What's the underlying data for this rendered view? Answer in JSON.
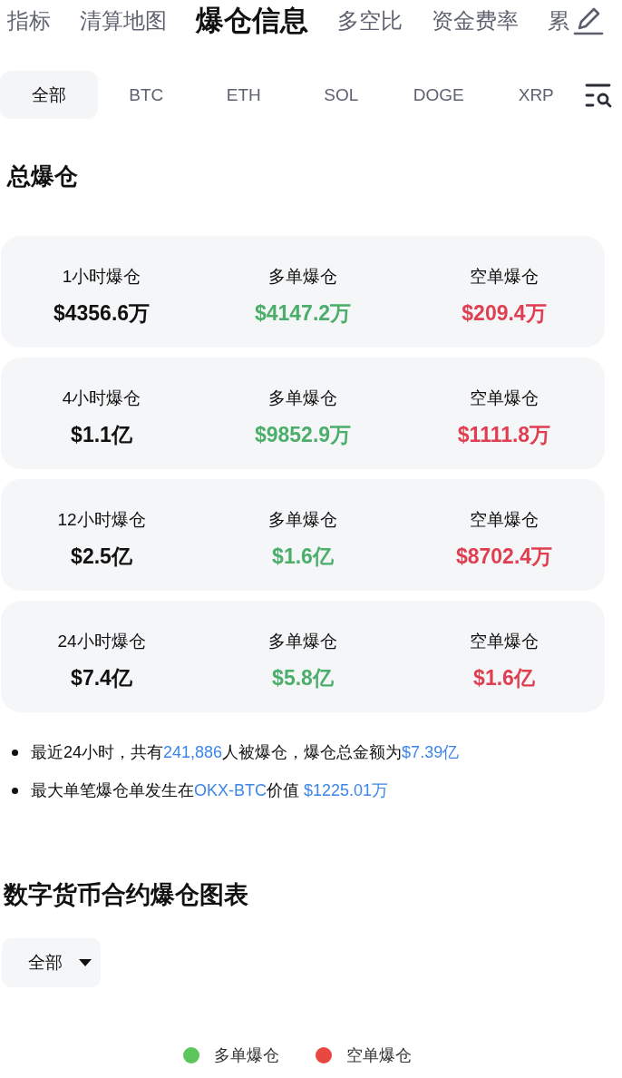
{
  "nav_tabs": [
    {
      "label": "指标",
      "selected": false
    },
    {
      "label": "清算地图",
      "selected": false
    },
    {
      "label": "爆仓信息",
      "selected": true
    },
    {
      "label": "多空比",
      "selected": false
    },
    {
      "label": "资金费率",
      "selected": false
    },
    {
      "label": "累",
      "selected": false
    }
  ],
  "coin_filters": [
    {
      "label": "全部",
      "selected": true
    },
    {
      "label": "BTC",
      "selected": false
    },
    {
      "label": "ETH",
      "selected": false
    },
    {
      "label": "SOL",
      "selected": false
    },
    {
      "label": "DOGE",
      "selected": false
    },
    {
      "label": "XRP",
      "selected": false
    }
  ],
  "total_liquidation": {
    "title": "总爆仓",
    "cards": [
      {
        "cells": [
          {
            "kind": "total",
            "label": "1小时爆仓",
            "value": "$4356.6万"
          },
          {
            "kind": "long",
            "label": "多单爆仓",
            "value": "$4147.2万"
          },
          {
            "kind": "short",
            "label": "空单爆仓",
            "value": "$209.4万"
          }
        ]
      },
      {
        "cells": [
          {
            "kind": "total",
            "label": "4小时爆仓",
            "value": "$1.1亿"
          },
          {
            "kind": "long",
            "label": "多单爆仓",
            "value": "$9852.9万"
          },
          {
            "kind": "short",
            "label": "空单爆仓",
            "value": "$1111.8万"
          }
        ]
      },
      {
        "cells": [
          {
            "kind": "total",
            "label": "12小时爆仓",
            "value": "$2.5亿"
          },
          {
            "kind": "long",
            "label": "多单爆仓",
            "value": "$1.6亿"
          },
          {
            "kind": "short",
            "label": "空单爆仓",
            "value": "$8702.4万"
          }
        ]
      },
      {
        "cells": [
          {
            "kind": "total",
            "label": "24小时爆仓",
            "value": "$7.4亿"
          },
          {
            "kind": "long",
            "label": "多单爆仓",
            "value": "$5.8亿"
          },
          {
            "kind": "short",
            "label": "空单爆仓",
            "value": "$1.6亿"
          }
        ]
      }
    ]
  },
  "notes": [
    {
      "segments": [
        {
          "kind": "text",
          "text": "最近24小时，共有"
        },
        {
          "kind": "value",
          "text": "241,886"
        },
        {
          "kind": "text",
          "text": "人被爆仓，爆仓总金额为"
        },
        {
          "kind": "value",
          "text": "$7.39亿"
        }
      ]
    },
    {
      "segments": [
        {
          "kind": "text",
          "text": "最大单笔爆仓单发生在"
        },
        {
          "kind": "value",
          "text": "OKX-BTC"
        },
        {
          "kind": "text",
          "text": "价值 "
        },
        {
          "kind": "value",
          "text": "$1225.01万"
        }
      ]
    }
  ],
  "chart_section": {
    "title": "数字货币合约爆仓图表",
    "dropdown": {
      "value": "全部"
    },
    "legend": [
      {
        "label": "多单爆仓",
        "color": "#5cc65a"
      },
      {
        "label": "空单爆仓",
        "color": "#e8483f"
      }
    ]
  }
}
